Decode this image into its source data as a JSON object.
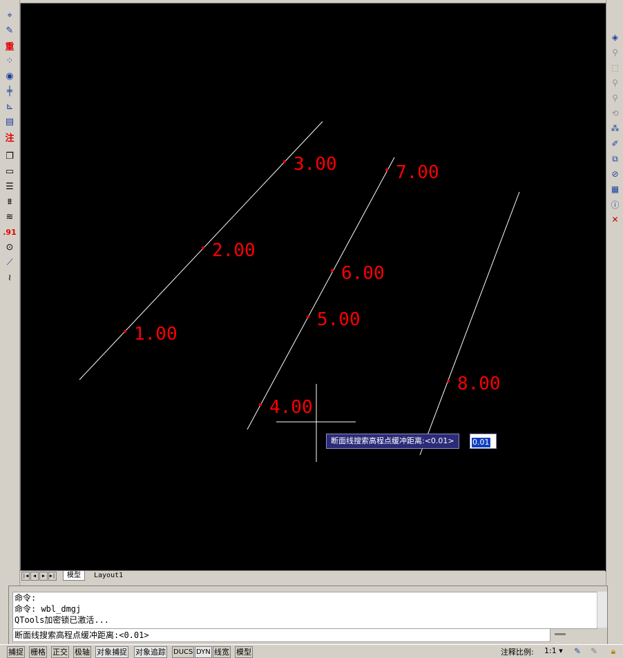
{
  "drawing": {
    "labels": [
      "3.00",
      "2.00",
      "1.00",
      "7.00",
      "6.00",
      "5.00",
      "4.00",
      "8.00"
    ]
  },
  "dynamic_input": {
    "prompt": "断面线搜索高程点缓冲距离:<0.01>",
    "value": "0.01"
  },
  "layout_tabs": {
    "model": "模型",
    "layout1": "Layout1"
  },
  "command": {
    "history": [
      "命令:",
      "命令: wbl_dmgj",
      "QTools加密锁已激活..."
    ],
    "current": "断面线搜索高程点缓冲距离:<0.01>"
  },
  "status_bar": {
    "buttons": [
      "捕捉",
      "栅格",
      "正交",
      "极轴",
      "对象捕捉",
      "对象追踪",
      "DUCS",
      "DYN",
      "线宽",
      "模型"
    ],
    "scale_label": "注释比例:",
    "scale_value": "1:1 ▾"
  },
  "left_toolbar": {
    "text_icons": [
      "重",
      "注",
      ".91"
    ]
  },
  "colors": {
    "canvas": "#000000",
    "label": "#ff0000",
    "line": "#ffffff",
    "dyn_prompt_bg": "#2b2b78"
  }
}
